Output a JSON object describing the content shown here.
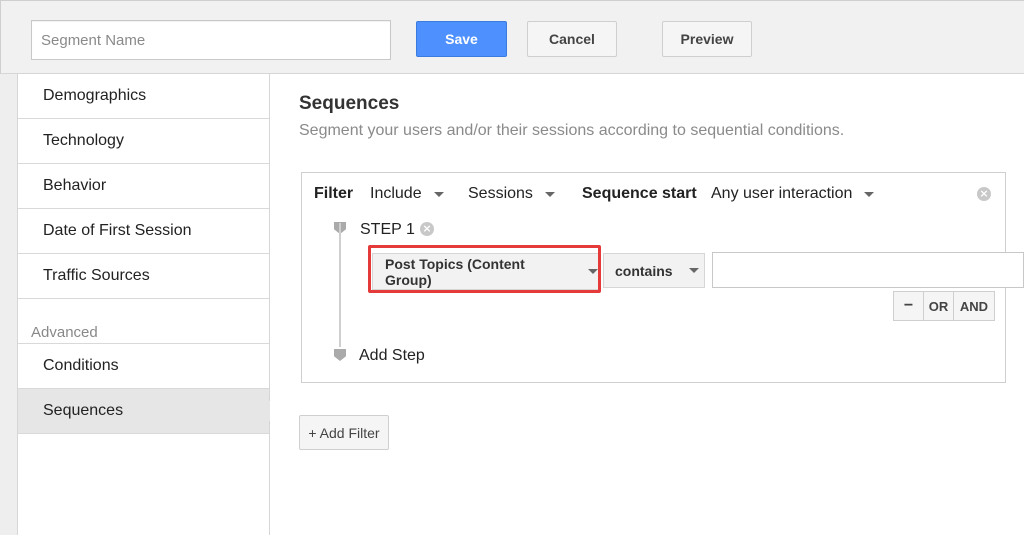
{
  "topbar": {
    "segment_name_placeholder": "Segment Name",
    "save_label": "Save",
    "cancel_label": "Cancel",
    "preview_label": "Preview"
  },
  "sidebar": {
    "items": [
      {
        "label": "Demographics"
      },
      {
        "label": "Technology"
      },
      {
        "label": "Behavior"
      },
      {
        "label": "Date of First Session"
      },
      {
        "label": "Traffic Sources"
      }
    ],
    "advanced_heading": "Advanced",
    "advanced_items": [
      {
        "label": "Conditions"
      },
      {
        "label": "Sequences",
        "active": true
      }
    ]
  },
  "main": {
    "title": "Sequences",
    "subtitle": "Segment your users and/or their sessions according to sequential conditions.",
    "filter": {
      "filter_label": "Filter",
      "include": "Include",
      "scope": "Sessions",
      "sequence_start_label": "Sequence start",
      "sequence_start_value": "Any user interaction",
      "remove_icon": "close-circle-icon",
      "step": {
        "label": "STEP 1",
        "dimension": "Post Topics (Content Group)",
        "operator": "contains",
        "value": "",
        "highlight_color": "#e43a3a"
      },
      "logic_buttons": {
        "minus": "−",
        "or": "OR",
        "and": "AND"
      },
      "add_step_label": "Add Step"
    },
    "add_filter_label": "+ Add Filter"
  },
  "colors": {
    "primary": "#4d90fe",
    "highlight": "#e43a3a"
  }
}
